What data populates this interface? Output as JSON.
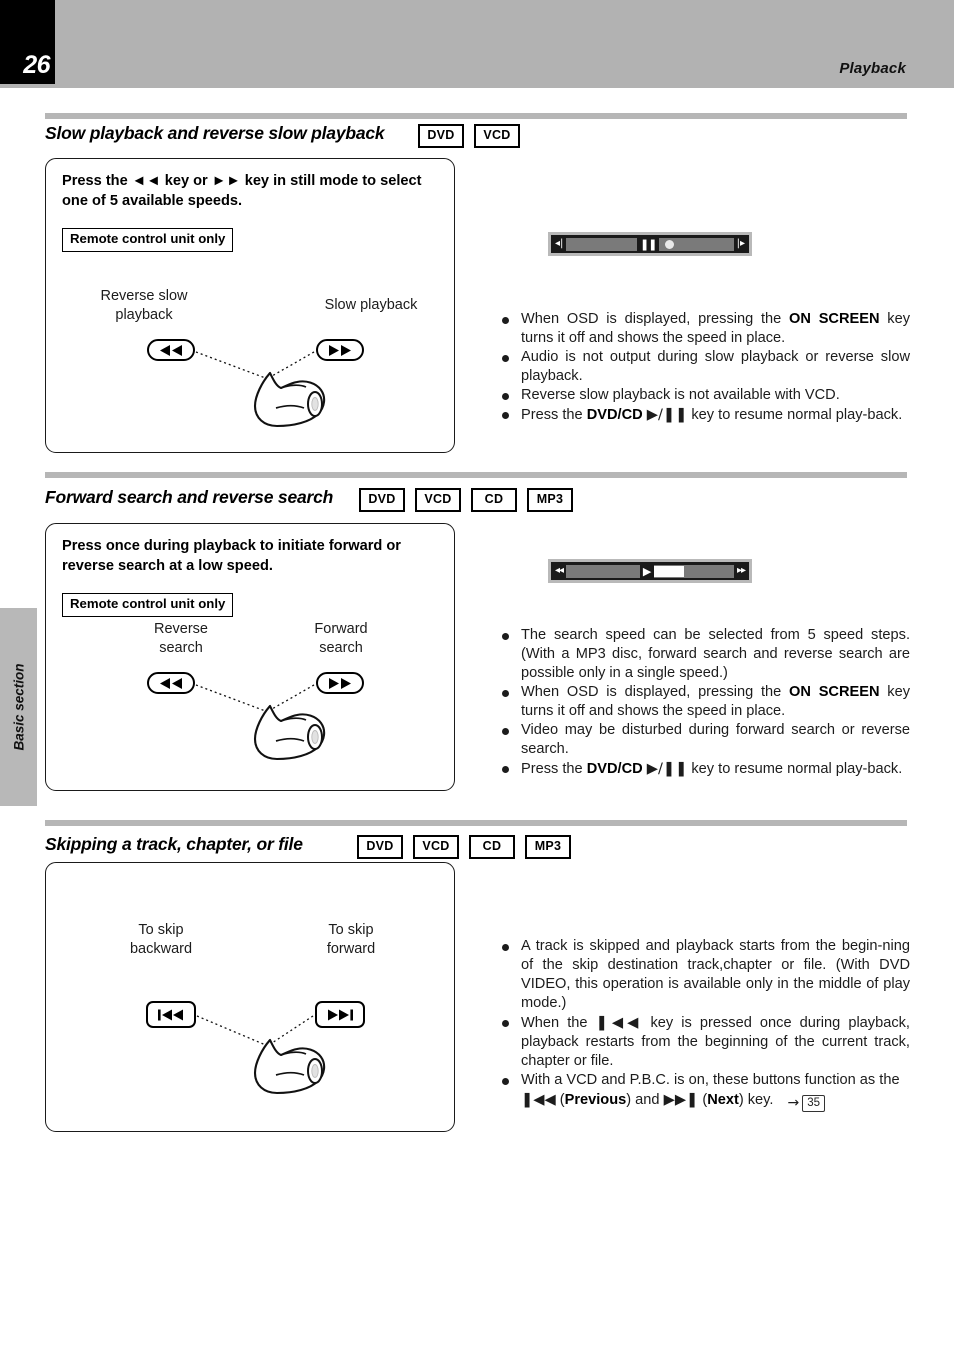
{
  "header": {
    "page_number": "26",
    "title": "Playback"
  },
  "side_tab": {
    "label": "Basic section"
  },
  "sections": [
    {
      "heading": "Slow playback and reverse slow playback",
      "badges": [
        "DVD",
        "VCD"
      ],
      "panel": {
        "lead": "Press the ◄◄ key or ►► key in still mode to select one of 5 available speeds.",
        "remote_note": "Remote control unit only",
        "left_label": "Reverse slow\nplayback",
        "right_label": "Slow playback",
        "left_key": "rew-key",
        "right_key": "ffwd-key"
      },
      "osd": {
        "name": "slow-playback-osd-bar",
        "left_icon": "step-reverse-icon",
        "right_icon": "step-forward-icon",
        "middle_icon": "pause-icon",
        "marker": "position-dot"
      },
      "bullets": [
        "When OSD is displayed, pressing the <b>ON SCREEN</b> key turns it off and shows the speed in place.",
        "Audio is not output during slow playback or reverse slow playback.",
        "Reverse slow playback is not available with VCD.",
        "Press the <b>DVD/CD</b> ►/▐▐ key to resume normal playback."
      ]
    },
    {
      "heading": "Forward search and reverse search",
      "badges": [
        "DVD",
        "VCD",
        "CD",
        "MP3"
      ],
      "panel": {
        "lead": "Press once during playback to initiate forward or reverse search at a low speed.",
        "remote_note": "Remote control unit only",
        "left_label": "Reverse\nsearch",
        "right_label": "Forward\nsearch",
        "left_key": "rew-key",
        "right_key": "ffwd-key"
      },
      "osd": {
        "name": "search-osd-bar",
        "left_icon": "rewind-icon",
        "right_icon": "fast-forward-icon",
        "middle_icon": "play-icon",
        "marker": "position-block"
      },
      "bullets": [
        "The search speed can be selected from 5 speed steps. (With a MP3 disc, forward search and reverse search are possible only in a single speed.)",
        "When OSD is displayed, pressing the <b>ON SCREEN</b> key turns it off and shows the speed in place.",
        "Video may be disturbed during forward search or reverse search.",
        "Press the <b>DVD/CD</b> ►/▐▐ key to resume normal playback."
      ]
    },
    {
      "heading": "Skipping a track, chapter, or file",
      "badges": [
        "DVD",
        "VCD",
        "CD",
        "MP3"
      ],
      "panel": {
        "lead": "",
        "remote_note": "",
        "left_label": "To skip\nbackward",
        "right_label": "To skip\nforward",
        "left_key": "skip-back-key",
        "right_key": "skip-forward-key"
      },
      "bullets": [
        "A track is skipped and playback starts from the beginning of the skip destination track,chapter or file. (With DVD VIDEO, this operation is available only in the middle of play mode.)",
        "When the ⏮ key is pressed once during playback, playback restarts from the beginning of the current track, chapter or file.",
        "With a VCD and P.B.C. is on, these buttons function as the ⏮ (<b>Previous</b>) and ⏭ (<b>Next</b>) key."
      ],
      "page_reference": "35"
    }
  ],
  "colors": {
    "header_band": "#b2b2b2",
    "page_box": "#000000",
    "side_tab": "#b8b8b8",
    "rule": "#b6b6b6",
    "osd_frame": "#b9b9b9",
    "osd_track": "#1a1a1a",
    "osd_segment": "#7a7a7a"
  }
}
